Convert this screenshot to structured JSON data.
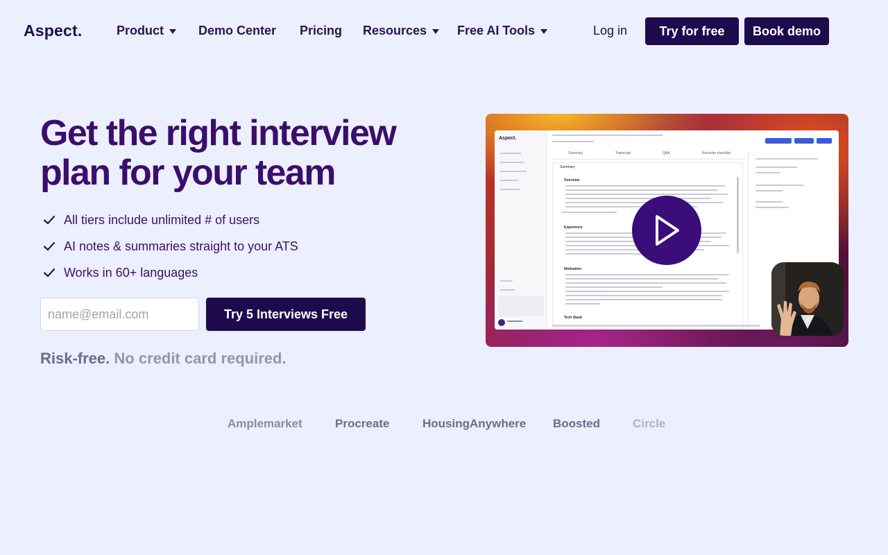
{
  "nav": {
    "logo": "Aspect.",
    "items": [
      {
        "label": "Product"
      },
      {
        "label": "Demo Center"
      },
      {
        "label": "Pricing"
      },
      {
        "label": "Resources"
      },
      {
        "label": "Free AI Tools"
      }
    ],
    "login": "Log in",
    "try_free": "Try for free",
    "book_demo": "Book demo"
  },
  "hero": {
    "title": "Get the right interview plan for your team",
    "features": [
      "All tiers include unlimited # of users",
      "AI notes & summaries straight to your ATS",
      "Works in 60+ languages"
    ],
    "email_placeholder": "name@email.com",
    "cta": "Try 5 Interviews Free",
    "risk_a": "Risk-free.",
    "risk_b": "No credit card required."
  },
  "video": {
    "app_logo": "Aspect.",
    "tabs": [
      "Summary",
      "Transcript",
      "Q&A",
      "Recruiter checklist"
    ],
    "summary_header": "Summary",
    "sections": [
      "Overview",
      "Experience",
      "Motivation",
      "Tech Stack"
    ]
  },
  "customers": [
    "Amplemarket",
    "Procreate",
    "HousingAnywhere",
    "Boosted",
    "Circle"
  ],
  "colors": {
    "background": "#eceffd",
    "primary": "#1e0b4e",
    "heading": "#3b0e6b",
    "play_button": "#3a0d7a"
  }
}
